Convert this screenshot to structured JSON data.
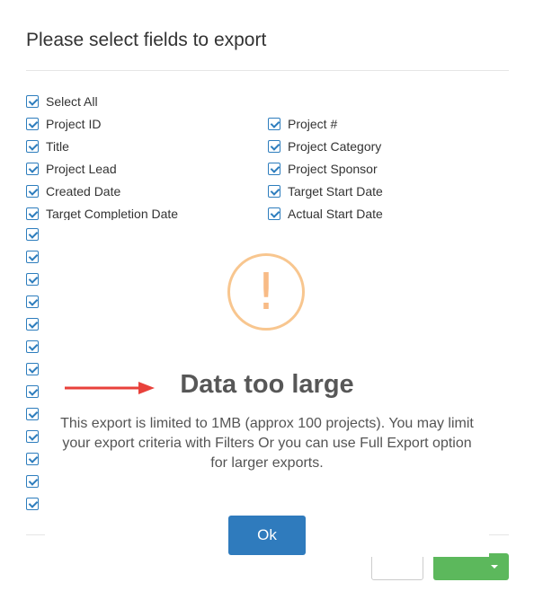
{
  "dialog": {
    "title": "Please select fields to export"
  },
  "fields": {
    "select_all": "Select All",
    "left": [
      "Project ID",
      "Title",
      "Project Lead",
      "Created Date",
      "Target Completion Date"
    ],
    "right": [
      "Project #",
      "Project Category",
      "Project Sponsor",
      "Target Start Date",
      "Actual Start Date"
    ]
  },
  "alert": {
    "title": "Data too large",
    "message": "This export is limited to 1MB (approx 100 projects). You may limit your export criteria with Filters Or you can use Full Export option for larger exports.",
    "ok_label": "Ok",
    "icon": "exclamation-icon",
    "accent_color": "#f8bb86",
    "annotation_arrow_color": "#e8413b"
  },
  "colors": {
    "checkbox": "#2d7dbd",
    "ok_button": "#2f7bbd",
    "export_button": "#5cb85c"
  }
}
